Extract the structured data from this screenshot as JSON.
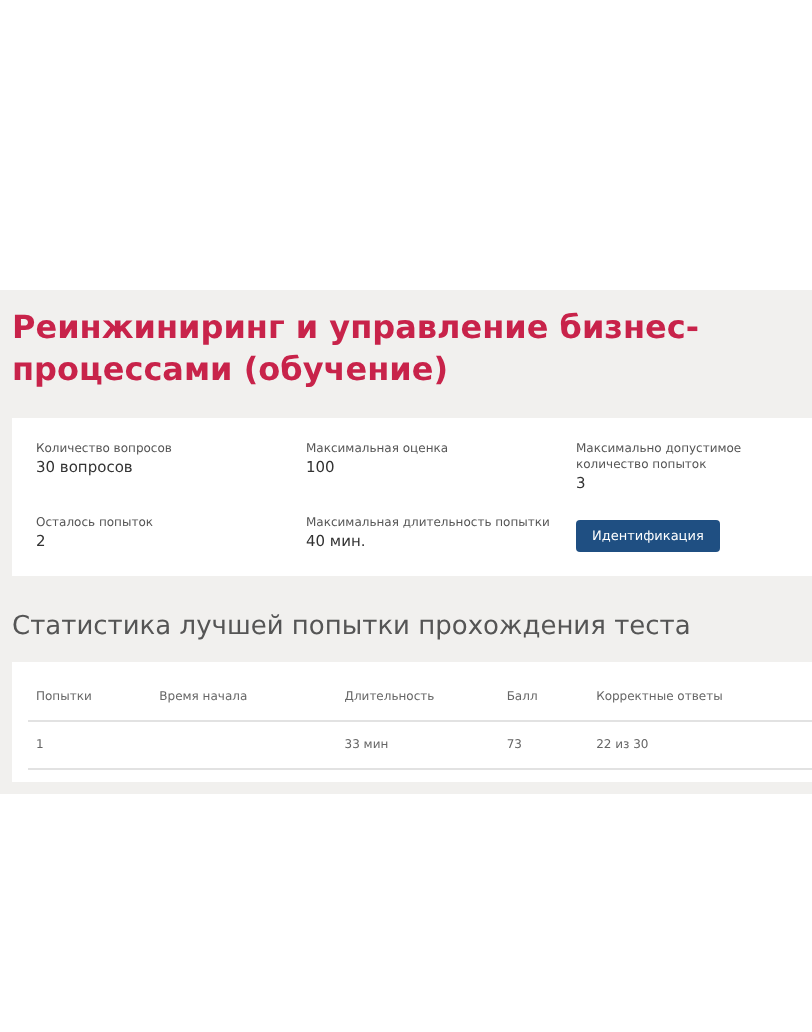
{
  "title": "Реинжиниринг и управление бизнес-процессами (обучение)",
  "info": [
    {
      "label": "Количество вопросов",
      "value": "30 вопросов"
    },
    {
      "label": "Максимальная оценка",
      "value": "100"
    },
    {
      "label": "Максимально допустимое количество попыток",
      "value": "3"
    },
    {
      "label": "Осталось попыток",
      "value": "2"
    },
    {
      "label": "Максимальная длительность попытки",
      "value": "40 мин."
    }
  ],
  "identify_button": "Идентификация",
  "stats_heading": "Статистика лучшей попытки прохождения теста",
  "table": {
    "columns": [
      "Попытки",
      "Время начала",
      "Длительность",
      "Балл",
      "Корректные ответы"
    ],
    "rows": [
      [
        "1",
        "",
        "33 мин",
        "73",
        "22 из 30"
      ]
    ]
  }
}
